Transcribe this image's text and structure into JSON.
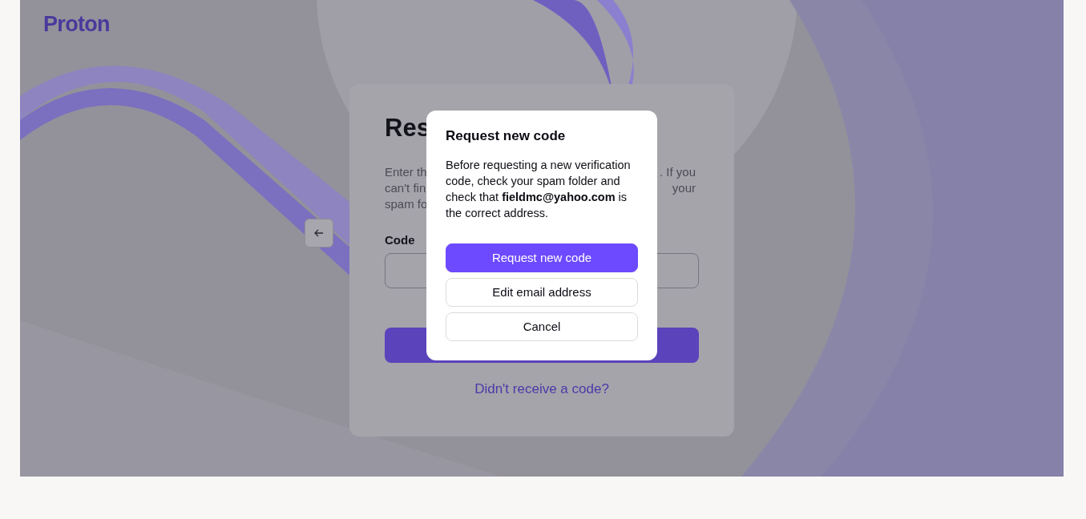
{
  "logo": {
    "text": "Proton"
  },
  "card": {
    "title": "Res",
    "description_lines": [
      {
        "left": "Enter th",
        "right": ". If you"
      },
      {
        "left": "can't fin",
        "right": "your"
      },
      {
        "left": "spam fo"
      }
    ],
    "code_label": "Code",
    "link": "Didn't receive a code?"
  },
  "modal": {
    "title": "Request new code",
    "body": "Before requesting a new verification code, check your spam folder and check that **fieldmc@yahoo.com** is the correct address.",
    "buttons": [
      {
        "label": "Request new code",
        "kind": "primary"
      },
      {
        "label": "Edit email address",
        "kind": "outline"
      },
      {
        "label": "Cancel",
        "kind": "outline"
      }
    ]
  }
}
